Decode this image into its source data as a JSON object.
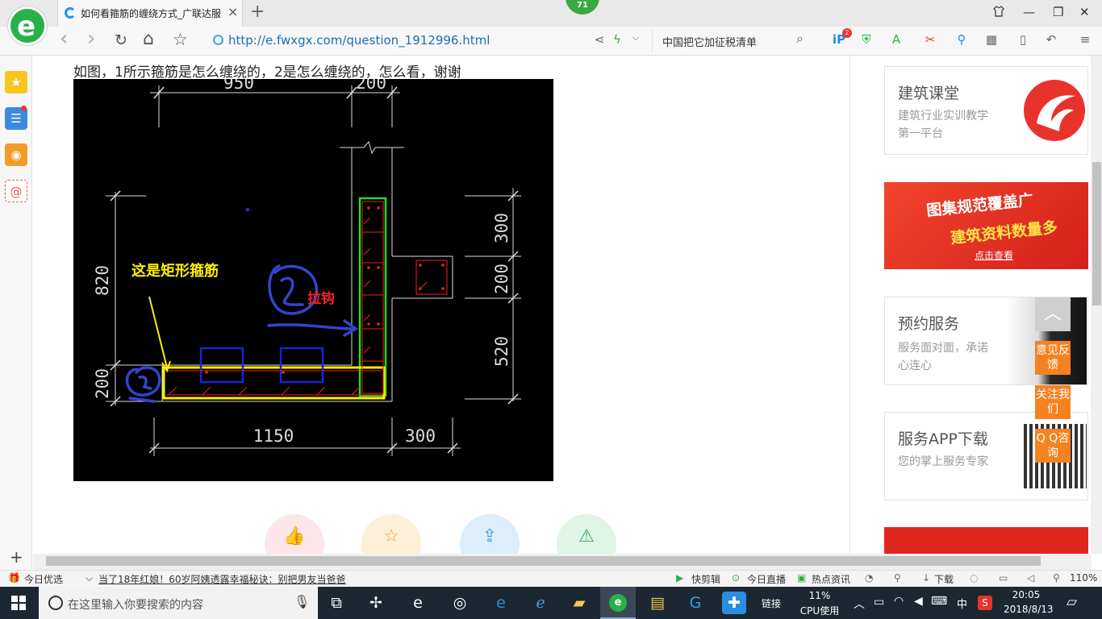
{
  "tab": {
    "title": "如何看箍筋的缠绕方式_广联达服",
    "close": "×",
    "new_tab": "+"
  },
  "badge": {
    "count": "71"
  },
  "window": {
    "restore_icon": "❐",
    "minimize": "—",
    "maximize": "□",
    "close": "✕",
    "skin": "shirt-icon"
  },
  "nav": {
    "back": "‹",
    "forward": "›",
    "reload": "↻",
    "home": "⌂",
    "favorite": "☆"
  },
  "address": {
    "url": "http://e.fwxgx.com/question_1912996.html"
  },
  "search": {
    "text": "中国把它加征税清单"
  },
  "toolbar": {
    "badge": "2"
  },
  "question": {
    "text": "如图，1所示箍筋是怎么缠绕的，2是怎么缠绕的，怎么看，谢谢"
  },
  "cad": {
    "dims": [
      "950",
      "200",
      "300",
      "200",
      "520",
      "820",
      "200",
      "1150",
      "300"
    ],
    "label_rect": "这是矩形箍筋",
    "label_hook": "拉钩"
  },
  "actions": [
    {
      "name": "like",
      "glyph": "👍",
      "bg": "#fde6ea",
      "fg": "#ef6c7f"
    },
    {
      "name": "favorite",
      "glyph": "☆",
      "bg": "#fdf0d8",
      "fg": "#e8a93a"
    },
    {
      "name": "share",
      "glyph": "⇪",
      "bg": "#dceefb",
      "fg": "#3b9ae0"
    },
    {
      "name": "report",
      "glyph": "⚠",
      "bg": "#dff5e5",
      "fg": "#3aad5c"
    }
  ],
  "sidebar": {
    "card1": {
      "title": "建筑课堂",
      "desc": "建筑行业实训教学第一平台"
    },
    "banner1": {
      "line1": "图集规范覆盖广",
      "line2": "建筑资料数量多",
      "cta": "点击查看"
    },
    "card2": {
      "title": "预约服务",
      "desc": "服务面对面，承诺心连心"
    },
    "card3": {
      "title": "服务APP下载",
      "desc": "您的掌上服务专家"
    }
  },
  "float": {
    "top": "︿",
    "feedback": "意见反馈",
    "follow": "关注我们",
    "qq": "Q Q咨询"
  },
  "statusbar": {
    "today": "今日优选",
    "news": "当了18年红娘！60岁阿姨透露幸福秘诀：别把男友当爸爸",
    "kuaijian": "快剪辑",
    "live": "今日直播",
    "hot": "热点资讯",
    "download": "下载",
    "zoom": "110%"
  },
  "taskbar": {
    "search_placeholder": "在这里输入你要搜索的内容",
    "link": "链接",
    "cpu_pct": "11%",
    "cpu_label": "CPU使用",
    "ime": "中",
    "time": "20:05",
    "date": "2018/8/13"
  },
  "colors": {
    "accent_green": "#27b14b",
    "orange": "#f58220",
    "taskbar": "#1c2731"
  }
}
